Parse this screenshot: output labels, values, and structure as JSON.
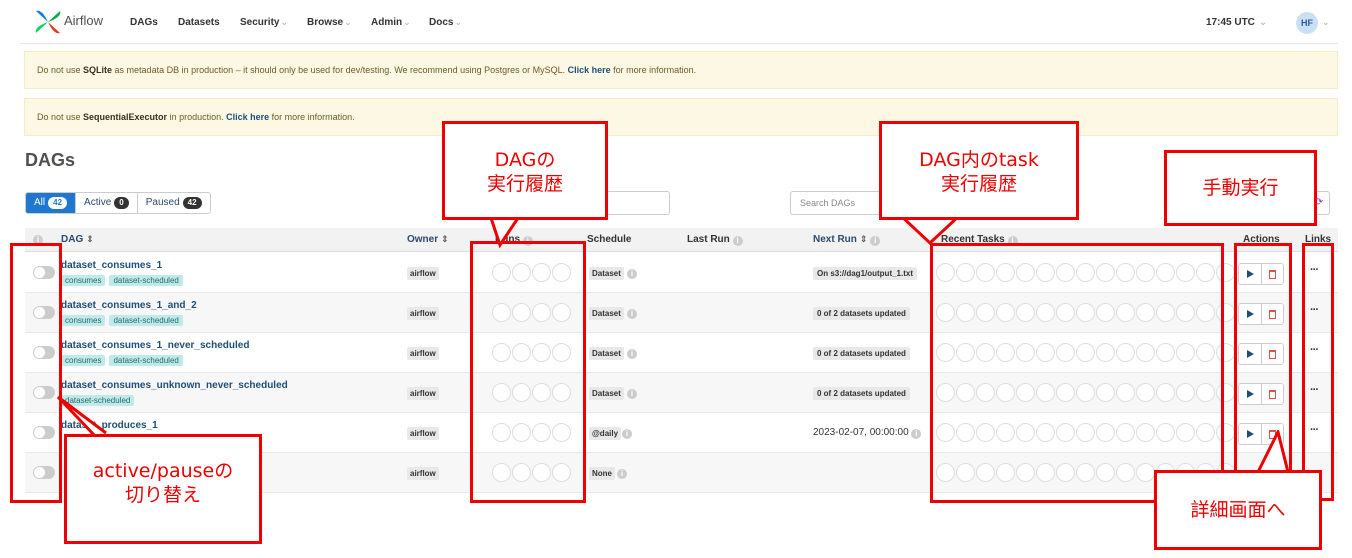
{
  "navbar": {
    "brand": "Airflow",
    "items": [
      {
        "label": "DAGs",
        "dropdown": false
      },
      {
        "label": "Datasets",
        "dropdown": false
      },
      {
        "label": "Security",
        "dropdown": true
      },
      {
        "label": "Browse",
        "dropdown": true
      },
      {
        "label": "Admin",
        "dropdown": true
      },
      {
        "label": "Docs",
        "dropdown": true
      }
    ],
    "time": "17:45 UTC",
    "avatar": "HF"
  },
  "alerts": {
    "sqlite": {
      "pre": "Do not use ",
      "bold": "SQLite",
      "mid": " as metadata DB in production – it should only be used for dev/testing. We recommend using Postgres or MySQL. ",
      "link": "Click here",
      "post": " for more information."
    },
    "executor": {
      "pre": "Do not use ",
      "bold": "SequentialExecutor",
      "mid": " in production. ",
      "link": "Click here",
      "post": " for more information."
    }
  },
  "page_title": "DAGs",
  "filters": [
    {
      "label": "All",
      "count": "42",
      "active": true
    },
    {
      "label": "Active",
      "count": "0",
      "active": false
    },
    {
      "label": "Paused",
      "count": "42",
      "active": false
    }
  ],
  "search_placeholder": "Search DAGs",
  "columns": {
    "dag": "DAG",
    "owner": "Owner",
    "runs": "Runs",
    "schedule": "Schedule",
    "last_run": "Last Run",
    "next_run": "Next Run",
    "recent_tasks": "Recent Tasks",
    "actions": "Actions",
    "links": "Links"
  },
  "rows": [
    {
      "name": "dataset_consumes_1",
      "tags": [
        "consumes",
        "dataset-scheduled"
      ],
      "owner": "airflow",
      "schedule": "Dataset",
      "next_run": "On s3://dag1/output_1.txt",
      "next_run_badge": true
    },
    {
      "name": "dataset_consumes_1_and_2",
      "tags": [
        "consumes",
        "dataset-scheduled"
      ],
      "owner": "airflow",
      "schedule": "Dataset",
      "next_run": "0 of 2 datasets updated",
      "next_run_badge": true
    },
    {
      "name": "dataset_consumes_1_never_scheduled",
      "tags": [
        "consumes",
        "dataset-scheduled"
      ],
      "owner": "airflow",
      "schedule": "Dataset",
      "next_run": "0 of 2 datasets updated",
      "next_run_badge": true
    },
    {
      "name": "dataset_consumes_unknown_never_scheduled",
      "tags": [
        "dataset-scheduled"
      ],
      "owner": "airflow",
      "schedule": "Dataset",
      "next_run": "0 of 2 datasets updated",
      "next_run_badge": true
    },
    {
      "name": "dataset_produces_1",
      "tags": [],
      "owner": "airflow",
      "schedule": "@daily",
      "next_run": "2023-02-07, 00:00:00",
      "next_run_badge": false
    },
    {
      "name": "",
      "tags": [],
      "owner": "airflow",
      "schedule": "None",
      "next_run": "",
      "next_run_badge": false
    }
  ],
  "annotations": {
    "runs": [
      "DAGの",
      "実行履歴"
    ],
    "recent_tasks": [
      "DAG内のtask",
      "実行履歴"
    ],
    "trigger": "手動実行",
    "details": "詳細画面へ",
    "toggle": [
      "active/pauseの",
      "切り替え"
    ]
  },
  "colors": {
    "accent": "#1f77d0",
    "annotation": "#ee0000",
    "alert_bg": "#fcf8e3",
    "tag_bg": "#bfeae9"
  }
}
